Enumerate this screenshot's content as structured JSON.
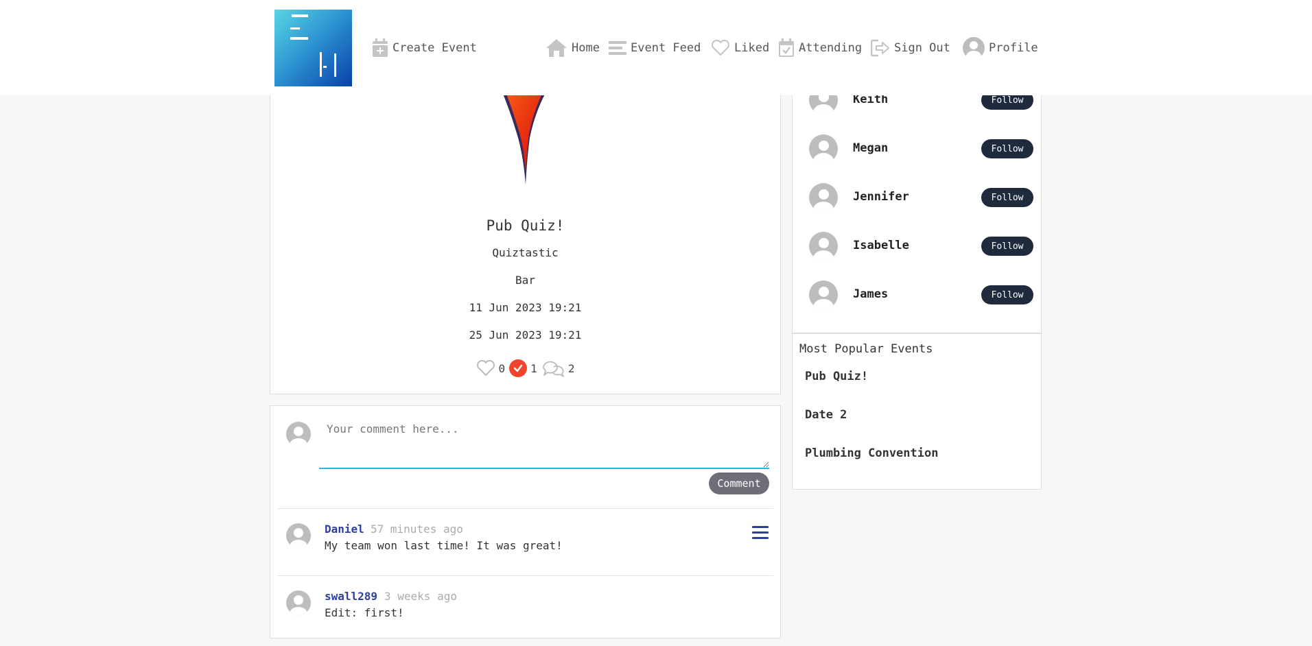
{
  "nav": {
    "create_event": "Create Event",
    "home": "Home",
    "event_feed": "Event Feed",
    "liked": "Liked",
    "attending": "Attending",
    "sign_out": "Sign Out",
    "profile": "Profile"
  },
  "event": {
    "title": "Pub Quiz!",
    "organizer": "Quiztastic",
    "location": "Bar",
    "start": "11 Jun 2023 19:21",
    "end": "25 Jun 2023 19:21",
    "likes": "0",
    "attending": "1",
    "comments": "2"
  },
  "comment_form": {
    "placeholder": "Your comment here...",
    "submit_label": "Comment"
  },
  "comments": [
    {
      "author": "Daniel",
      "time": "57 minutes ago",
      "text": "My team won last time! It was great!"
    },
    {
      "author": "swall289",
      "time": "3 weeks ago",
      "text": "Edit: first!"
    }
  ],
  "sidebar": {
    "users": [
      {
        "name": "Keith",
        "follow_label": "Follow"
      },
      {
        "name": "Megan",
        "follow_label": "Follow"
      },
      {
        "name": "Jennifer",
        "follow_label": "Follow"
      },
      {
        "name": "Isabelle",
        "follow_label": "Follow"
      },
      {
        "name": "James",
        "follow_label": "Follow"
      }
    ],
    "popular_title": "Most Popular Events",
    "popular_events": [
      "Pub Quiz!",
      "Date 2",
      "Plumbing Convention"
    ]
  },
  "colors": {
    "accent_red": "#f0442b",
    "link_blue": "#2c3fa0",
    "follow_button": "#1f2a3c",
    "input_underline": "#29b2de"
  }
}
